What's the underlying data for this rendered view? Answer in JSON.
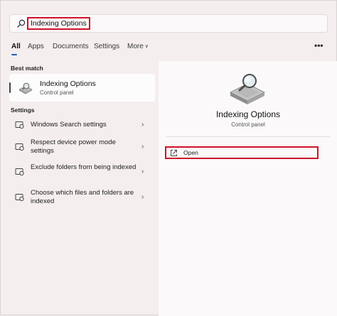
{
  "search": {
    "query": "Indexing Options"
  },
  "tabs": [
    {
      "label": "All"
    },
    {
      "label": "Apps"
    },
    {
      "label": "Documents"
    },
    {
      "label": "Settings"
    },
    {
      "label": "More"
    }
  ],
  "more_menu_glyph": "•••",
  "sections": {
    "best_match_label": "Best match",
    "settings_label": "Settings"
  },
  "best_match": {
    "title": "Indexing Options",
    "subtitle": "Control panel",
    "icon": "indexing-options-icon"
  },
  "settings_items": [
    {
      "label": "Windows Search settings",
      "icon": "search-settings-icon"
    },
    {
      "label": "Respect device power mode settings",
      "icon": "power-mode-icon"
    },
    {
      "label": "Exclude folders from being indexed",
      "icon": "exclude-folders-icon"
    },
    {
      "label": "Choose which files and folders are indexed",
      "icon": "choose-files-icon"
    }
  ],
  "detail": {
    "title": "Indexing Options",
    "subtitle": "Control panel",
    "open_label": "Open"
  },
  "colors": {
    "highlight": "#d0112b",
    "accent": "#1f5fb8",
    "background": "#f4eeee",
    "panel": "#fbf9f9"
  }
}
